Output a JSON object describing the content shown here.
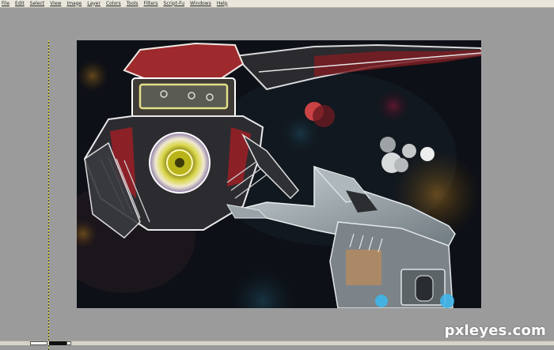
{
  "menubar": {
    "items": [
      "File",
      "Edit",
      "Select",
      "View",
      "Image",
      "Layer",
      "Colors",
      "Tools",
      "Filters",
      "Script-Fu",
      "Windows",
      "Help"
    ]
  },
  "canvas": {
    "background_color": "#9b9b9b",
    "guide_color": "#e8e01b",
    "painting_description_tokens": [
      "space-station",
      "spaceship",
      "nebula"
    ]
  },
  "watermark": {
    "text": "pxleyes.com"
  }
}
